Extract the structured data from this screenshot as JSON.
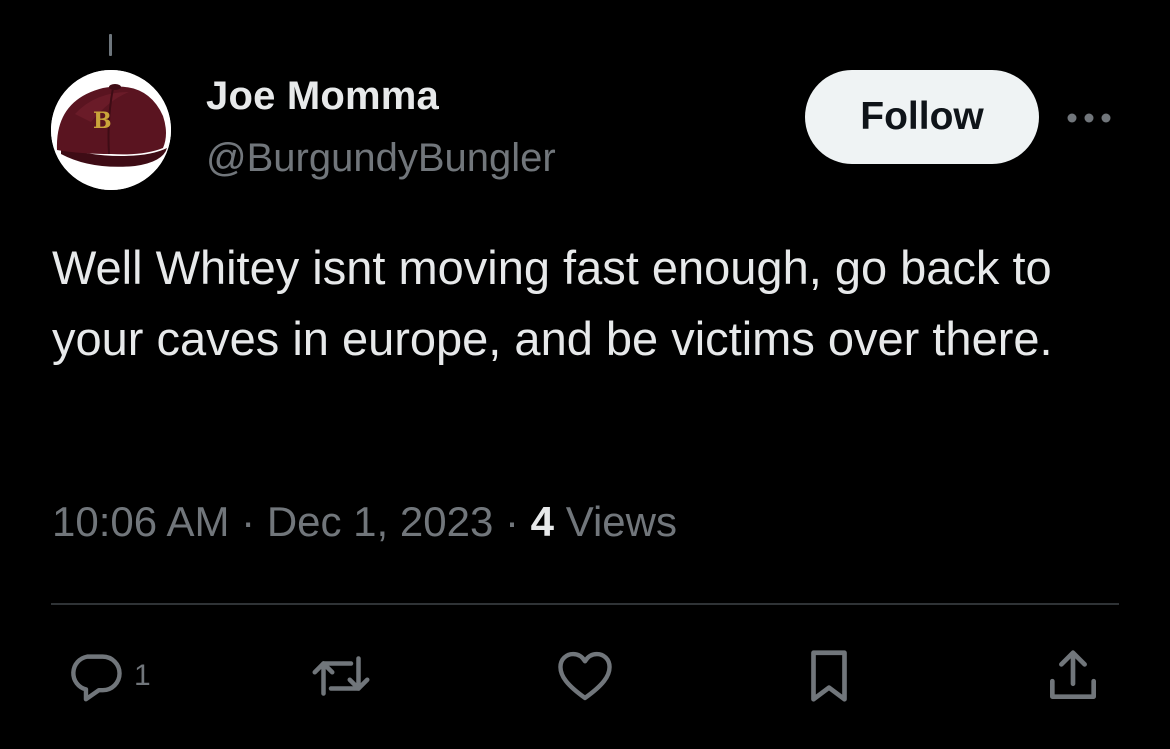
{
  "tweet": {
    "author": {
      "name": "Joe Momma",
      "handle": "@BurgundyBungler",
      "avatar_badge": "B"
    },
    "follow_label": "Follow",
    "text": "Well Whitey isnt moving fast enough, go back to your caves in europe, and be victims over there.",
    "time": "10:06 AM",
    "separator": "·",
    "date": "Dec 1, 2023",
    "views_count": "4",
    "views_label": "Views",
    "reply_count": "1"
  },
  "icons": {
    "more": "more-horizontal-icon",
    "reply": "reply-bubble-icon",
    "retweet": "retweet-icon",
    "like": "heart-icon",
    "bookmark": "bookmark-icon",
    "share": "share-upload-icon"
  },
  "colors": {
    "background": "#000000",
    "primary_text": "#e7e9ea",
    "secondary_text": "#71767b",
    "divider": "#2f3336",
    "follow_button_bg": "#eff3f4",
    "follow_button_text": "#0f1419",
    "avatar_cap": "#5a1420",
    "avatar_badge": "#c9a43a"
  }
}
